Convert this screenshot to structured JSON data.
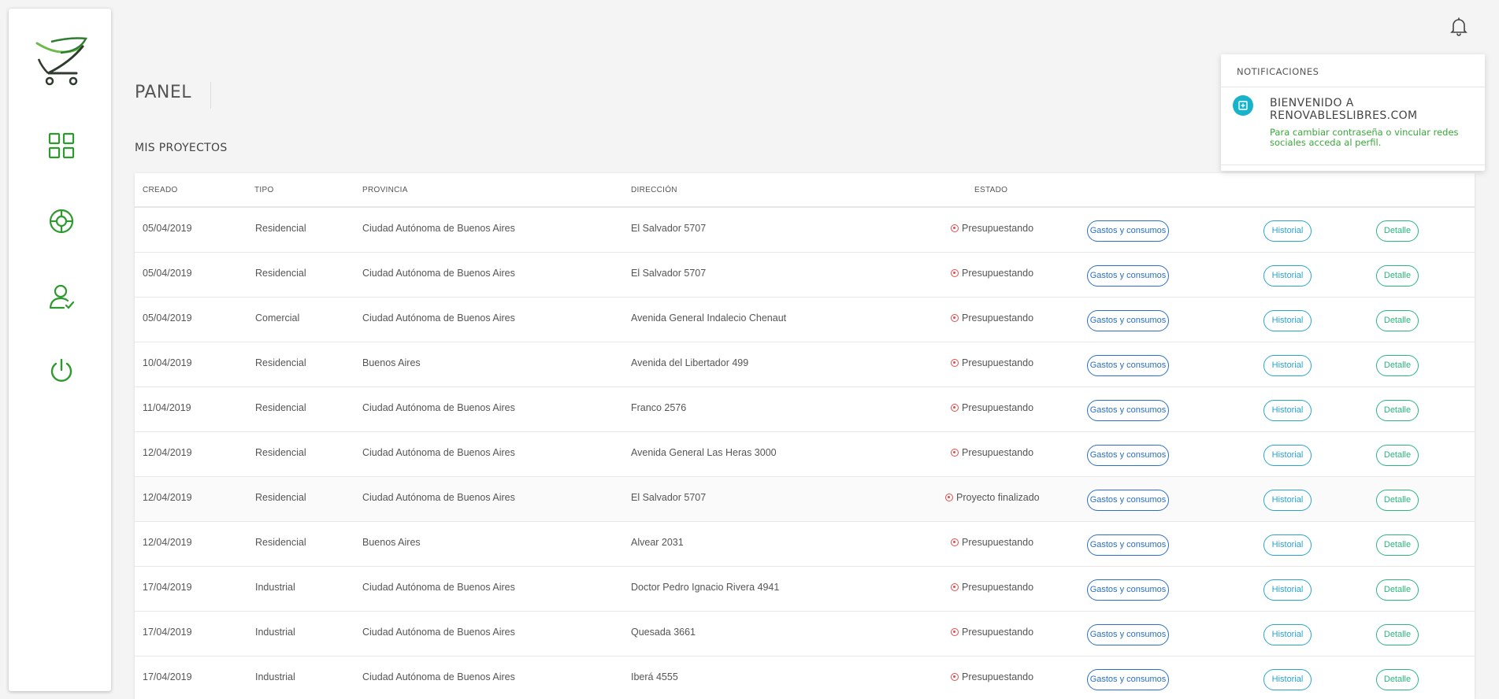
{
  "page": {
    "title": "PANEL",
    "section_title": "MIS PROYECTOS"
  },
  "colors": {
    "brand_green": "#2e9a2e",
    "status_red": "#e24b4b",
    "gastos_blue": "#2a6fc4",
    "historial_cyan": "#29a4cf",
    "detalle_green": "#29b77a",
    "notif_accent": "#17b3c8"
  },
  "sidebar": {
    "icons": [
      "logo-icon",
      "dashboard-grid-icon",
      "lifebuoy-icon",
      "user-check-icon",
      "power-icon"
    ]
  },
  "header": {
    "bell_icon": "bell-icon"
  },
  "notifications": {
    "title": "NOTIFICACIONES",
    "item": {
      "title": "BIENVENIDO A RENOVABLESLIBRES.COM",
      "body": "Para cambiar contraseña o vincular redes sociales acceda al perfil."
    }
  },
  "table": {
    "headers": {
      "created": "CREADO",
      "type": "TIPO",
      "province": "PROVINCIA",
      "address": "DIRECCIÓN",
      "status": "ESTADO"
    },
    "actions": {
      "gastos": "Gastos y consumos",
      "historial": "Historial",
      "detalle": "Detalle"
    },
    "rows": [
      {
        "created": "05/04/2019",
        "type": "Residencial",
        "province": "Ciudad Autónoma de Buenos Aires",
        "address": "El Salvador 5707",
        "status": "Presupuestando"
      },
      {
        "created": "05/04/2019",
        "type": "Residencial",
        "province": "Ciudad Autónoma de Buenos Aires",
        "address": "El Salvador 5707",
        "status": "Presupuestando"
      },
      {
        "created": "05/04/2019",
        "type": "Comercial",
        "province": "Ciudad Autónoma de Buenos Aires",
        "address": "Avenida General Indalecio Chenaut",
        "status": "Presupuestando"
      },
      {
        "created": "10/04/2019",
        "type": "Residencial",
        "province": "Buenos Aires",
        "address": "Avenida del Libertador 499",
        "status": "Presupuestando"
      },
      {
        "created": "11/04/2019",
        "type": "Residencial",
        "province": "Ciudad Autónoma de Buenos Aires",
        "address": "Franco 2576",
        "status": "Presupuestando"
      },
      {
        "created": "12/04/2019",
        "type": "Residencial",
        "province": "Ciudad Autónoma de Buenos Aires",
        "address": "Avenida General Las Heras 3000",
        "status": "Presupuestando"
      },
      {
        "created": "12/04/2019",
        "type": "Residencial",
        "province": "Ciudad Autónoma de Buenos Aires",
        "address": "El Salvador 5707",
        "status": "Proyecto finalizado"
      },
      {
        "created": "12/04/2019",
        "type": "Residencial",
        "province": "Buenos Aires",
        "address": "Alvear 2031",
        "status": "Presupuestando"
      },
      {
        "created": "17/04/2019",
        "type": "Industrial",
        "province": "Ciudad Autónoma de Buenos Aires",
        "address": "Doctor Pedro Ignacio Rivera 4941",
        "status": "Presupuestando"
      },
      {
        "created": "17/04/2019",
        "type": "Industrial",
        "province": "Ciudad Autónoma de Buenos Aires",
        "address": "Quesada 3661",
        "status": "Presupuestando"
      },
      {
        "created": "17/04/2019",
        "type": "Industrial",
        "province": "Ciudad Autónoma de Buenos Aires",
        "address": "Iberá 4555",
        "status": "Presupuestando"
      }
    ]
  }
}
